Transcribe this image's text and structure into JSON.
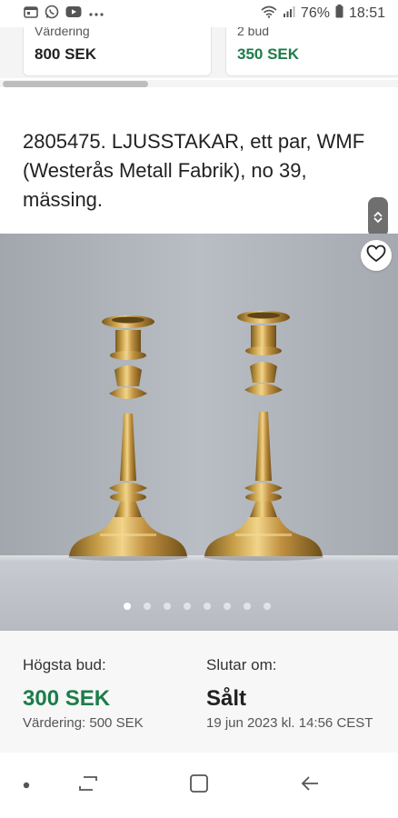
{
  "status_bar": {
    "battery_percent": "76%",
    "time": "18:51",
    "left_icons": [
      "calendar-icon",
      "whatsapp-icon",
      "youtube-icon",
      "more-dots-icon"
    ],
    "right_icons": [
      "wifi-icon",
      "signal-icon",
      "battery-icon"
    ]
  },
  "top_cards": [
    {
      "label": "Värdering",
      "value": "800 SEK",
      "color": "#222222"
    },
    {
      "label": "2 bud",
      "value": "350 SEK",
      "color": "#1c7d4a"
    }
  ],
  "listing": {
    "title": "2805475. LJUSSTAKAR, ett par, WMF (Westerås Metall Fabrik), no 39, mässing.",
    "image_count": 8,
    "active_image": 1
  },
  "info": {
    "highest_bid_label": "Högsta bud:",
    "highest_bid_value": "300 SEK",
    "valuation": "Värdering: 500 SEK",
    "ends_label": "Slutar om:",
    "ends_value": "Sålt",
    "ends_date": "19 jun 2023 kl. 14:56 CEST"
  },
  "colors": {
    "accent_green": "#1c7d4a",
    "brass": "#c9a04a"
  }
}
